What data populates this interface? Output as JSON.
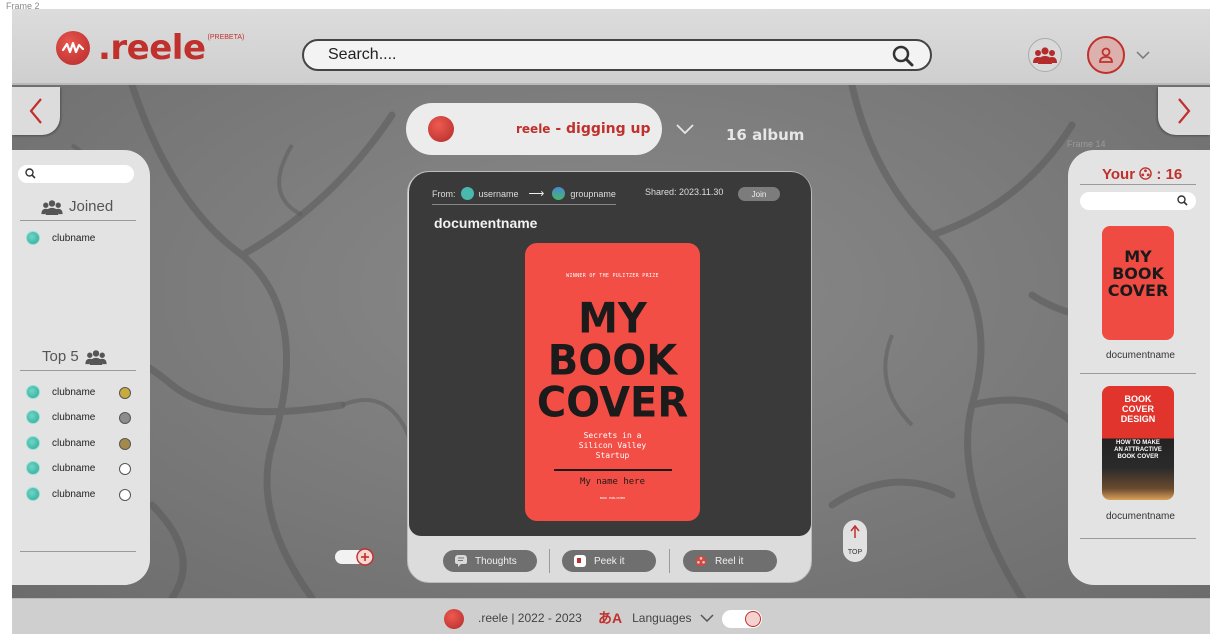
{
  "canvas": {
    "frame_label": "Frame 2",
    "frame14_label": "Frame 14"
  },
  "header": {
    "logo_text": ".reele",
    "logo_tag": "(PREBETA)",
    "search_placeholder": "Search...."
  },
  "album": {
    "brand": "reele",
    "name": " - digging up",
    "count": "16 album"
  },
  "left_panel": {
    "joined_label": "Joined",
    "joined_clubs": [
      "clubname"
    ],
    "top5_label": "Top 5",
    "top5_clubs": [
      "clubname",
      "clubname",
      "clubname",
      "clubname",
      "clubname"
    ],
    "medal_colors": [
      "#c8ab3f",
      "#8c8c8c",
      "#a48a4a",
      "#ffffff",
      "#ffffff"
    ]
  },
  "post": {
    "from_label": "From:",
    "username": "username",
    "groupname": "groupname",
    "shared": "Shared: 2023.11.30",
    "join_label": "Join",
    "document_name": "documentname",
    "cover": {
      "prize": "WINNER OF THE PULITZER PRIZE",
      "title_lines": [
        "MY",
        "BOOK",
        "COVER"
      ],
      "subtitle_lines": [
        "Secrets in a",
        "Silicon Valley",
        "Startup"
      ],
      "author": "My name here",
      "publisher": "BOOK PUBLISHER"
    },
    "actions": [
      {
        "label": "Thoughts",
        "icon": "speech-bubble-icon"
      },
      {
        "label": "Peek it",
        "icon": "peek-icon"
      },
      {
        "label": "Reel it",
        "icon": "reel-icon"
      }
    ]
  },
  "right_panel": {
    "yours_label": "Your",
    "yours_count": ": 16",
    "docs": [
      {
        "name": "documentname",
        "cover_title_lines": [
          "MY",
          "BOOK",
          "COVER"
        ]
      },
      {
        "name": "documentname",
        "cover_title_lines": [
          "BOOK",
          "COVER",
          "DESIGN"
        ],
        "cover_sub_lines": [
          "HOW TO MAKE",
          "AN ATTRACTIVE",
          "BOOK COVER"
        ]
      }
    ]
  },
  "top_button": {
    "label": "TOP"
  },
  "footer": {
    "brand_text": ".reele | 2022 - 2023",
    "languages_label": "Languages"
  },
  "colors": {
    "brand_red": "#c0302c",
    "cover_red": "#f24e45",
    "panel_gray": "#e3e3e3",
    "card_dark": "#3a3a3a",
    "club_teal": "#49b8ad"
  }
}
